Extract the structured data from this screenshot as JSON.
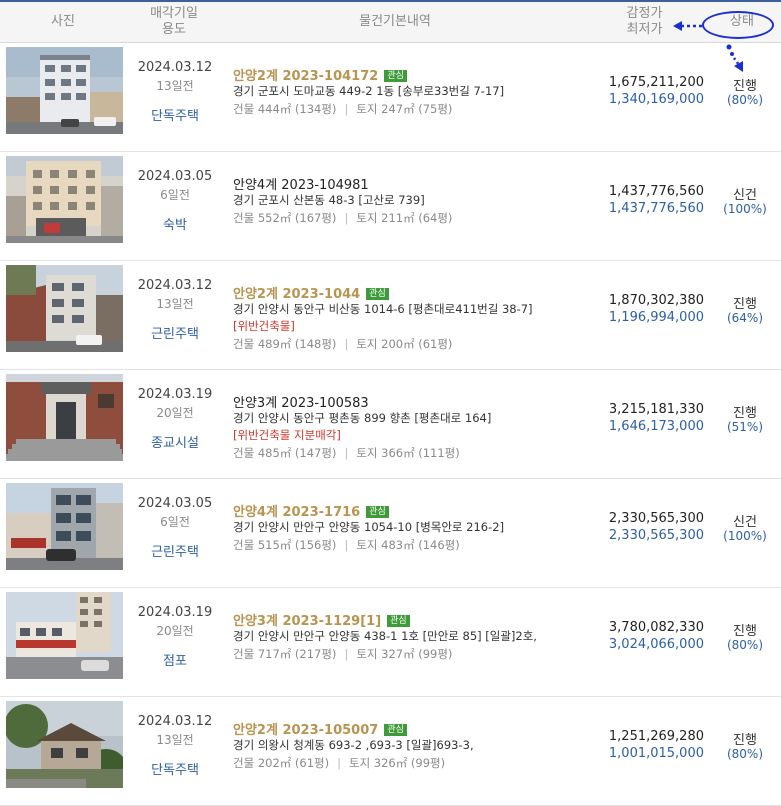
{
  "header": {
    "photo": "사진",
    "date_line1": "매각기일",
    "date_line2": "용도",
    "info": "물건기본내역",
    "price_line1": "감정가",
    "price_line2": "최저가",
    "status": "상태"
  },
  "colors": {
    "annotation": "#1a2fd1",
    "favorite_case": "#b89450",
    "badge": "#3f9a3a",
    "link_blue": "#2d5fa5",
    "warning": "#d0382b"
  },
  "rows": [
    {
      "date": "2024.03.12",
      "ago": "13일전",
      "usage": "단독주택",
      "case": "안양2계 2023-104172",
      "favorite": true,
      "badge": "관심",
      "address": "경기 군포시 도마교동 449-2 1동 [송부로33번길 7-17]",
      "warning": "",
      "building": "건물 444㎡ (134평)",
      "land": "토지 247㎡ (75평)",
      "appraisal": "1,675,211,200",
      "minimum": "1,340,169,000",
      "state": "진행",
      "percent": "(80%)",
      "photo": "white-apartment-building"
    },
    {
      "date": "2024.03.05",
      "ago": "6일전",
      "usage": "숙박",
      "case": "안양4계 2023-104981",
      "favorite": false,
      "badge": "",
      "address": "경기 군포시 산본동 48-3 [고산로 739]",
      "warning": "",
      "building": "건물 552㎡ (167평)",
      "land": "토지 211㎡ (64평)",
      "appraisal": "1,437,776,560",
      "minimum": "1,437,776,560",
      "state": "신건",
      "percent": "(100%)",
      "photo": "beige-building"
    },
    {
      "date": "2024.03.12",
      "ago": "13일전",
      "usage": "근린주택",
      "case": "안양2계 2023-1044",
      "favorite": true,
      "badge": "관심",
      "address": "경기 안양시 동안구 비산동 1014-6 [평촌대로411번길 38-7]",
      "warning": "[위반건축물]",
      "building": "건물 489㎡ (148평)",
      "land": "토지 200㎡ (61평)",
      "appraisal": "1,870,302,380",
      "minimum": "1,196,994,000",
      "state": "진행",
      "percent": "(64%)",
      "photo": "brick-building"
    },
    {
      "date": "2024.03.19",
      "ago": "20일전",
      "usage": "종교시설",
      "case": "안양3계 2023-100583",
      "favorite": false,
      "badge": "",
      "address": "경기 안양시 동안구 평촌동 899 향촌 [평촌대로 164]",
      "warning": "[위반건축물   지분매각]",
      "building": "건물 485㎡ (147평)",
      "land": "토지 366㎡ (111평)",
      "appraisal": "3,215,181,330",
      "minimum": "1,646,173,000",
      "state": "진행",
      "percent": "(51%)",
      "photo": "brick-entrance"
    },
    {
      "date": "2024.03.05",
      "ago": "6일전",
      "usage": "근린주택",
      "case": "안양4계 2023-1716",
      "favorite": true,
      "badge": "관심",
      "address": "경기 안양시 만안구 안양동 1054-10 [병목안로 216-2]",
      "warning": "",
      "building": "건물 515㎡ (156평)",
      "land": "토지 483㎡ (146평)",
      "appraisal": "2,330,565,300",
      "minimum": "2,330,565,300",
      "state": "신건",
      "percent": "(100%)",
      "photo": "grey-building-street"
    },
    {
      "date": "2024.03.19",
      "ago": "20일전",
      "usage": "점포",
      "case": "안양3계 2023-1129[1]",
      "favorite": true,
      "badge": "관심",
      "address": "경기 안양시 만안구 안양동 438-1 1호 [만안로 85]  [일괄]2호,",
      "warning": "",
      "building": "건물 717㎡ (217평)",
      "land": "토지 327㎡ (99평)",
      "appraisal": "3,780,082,330",
      "minimum": "3,024,066,000",
      "state": "진행",
      "percent": "(80%)",
      "photo": "shops-street"
    },
    {
      "date": "2024.03.12",
      "ago": "13일전",
      "usage": "단독주택",
      "case": "안양2계 2023-105007",
      "favorite": true,
      "badge": "관심",
      "address": "경기 의왕시 청계동 693-2 ,693-3  [일괄]693-3,",
      "warning": "",
      "building": "건물 202㎡ (61평)",
      "land": "토지 326㎡ (99평)",
      "appraisal": "1,251,269,280",
      "minimum": "1,001,015,000",
      "state": "진행",
      "percent": "(80%)",
      "photo": "house-with-trees"
    }
  ]
}
